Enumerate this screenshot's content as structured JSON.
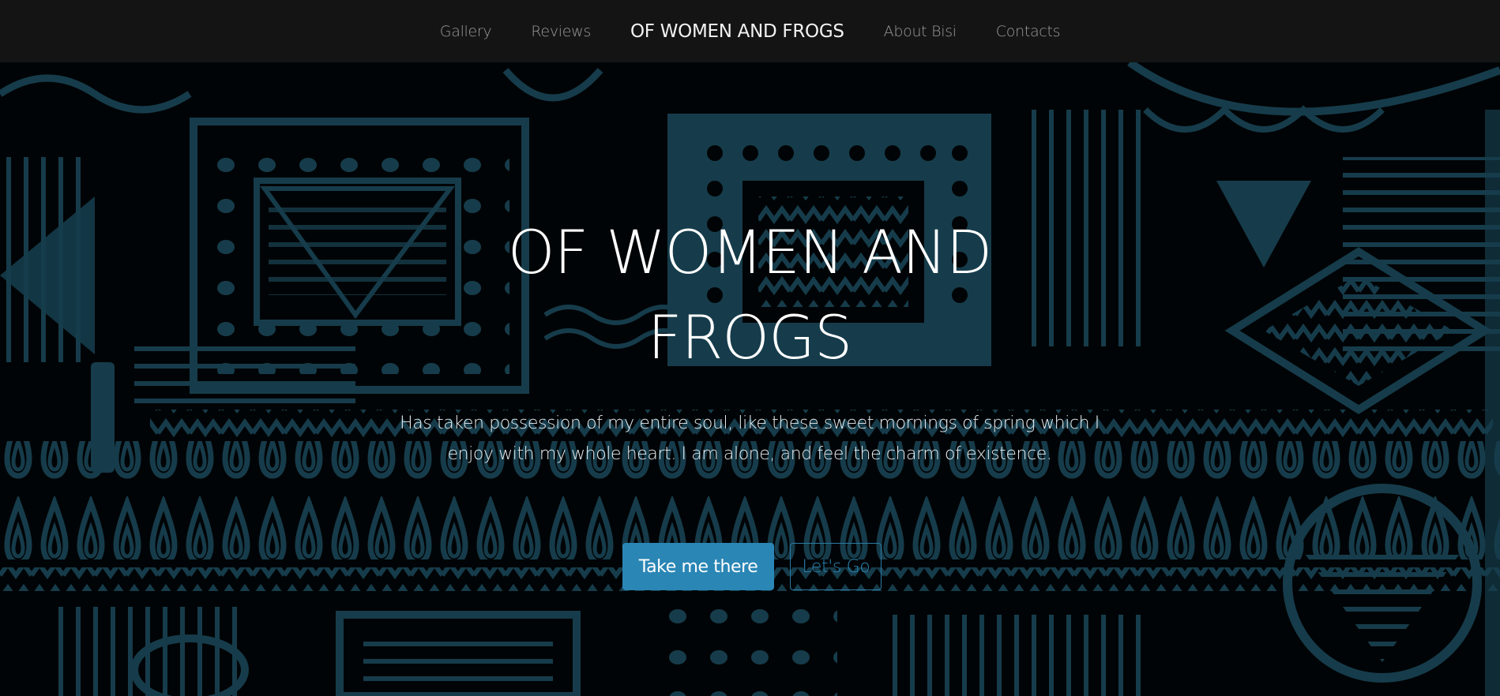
{
  "nav": {
    "links_left": [
      {
        "label": "Gallery"
      },
      {
        "label": "Reviews"
      }
    ],
    "brand": "OF WOMEN AND FROGS",
    "links_right": [
      {
        "label": "About Bisi"
      },
      {
        "label": "Contacts"
      }
    ]
  },
  "hero": {
    "title_line1": "OF WOMEN AND",
    "title_line2": "FROGS",
    "text_line1": "Has taken possession of my entire soul, like these sweet mornings of spring which I",
    "text_line2": "enjoy with my whole heart. I am alone, and feel the charm of existence.",
    "primary_button": "Take me there",
    "secondary_button": "Let's Go",
    "background_pattern": "tribal-pattern-teal-on-black"
  },
  "colors": {
    "navbar_bg": "#141414",
    "pattern_teal": "#1b4a5c",
    "accent_blue": "#2a86b5"
  }
}
